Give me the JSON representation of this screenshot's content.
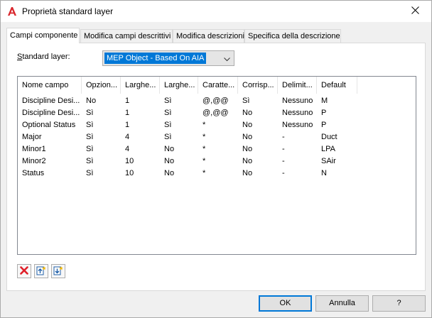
{
  "window": {
    "title": "Proprietà standard layer"
  },
  "tabs": [
    {
      "label": "Campi componente"
    },
    {
      "label": "Modifica campi descrittivi"
    },
    {
      "label": "Modifica descrizioni"
    },
    {
      "label": "Specifica della descrizione"
    }
  ],
  "standard": {
    "label_underlined": "S",
    "label_rest": "tandard layer:",
    "selected": "MEP Object - Based On AIA"
  },
  "table": {
    "columns": [
      "Nome campo",
      "Opzion...",
      "Larghe...",
      "Larghe...",
      "Caratte...",
      "Corrisp...",
      "Delimit...",
      "Default"
    ],
    "rows": [
      [
        "Discipline Desi...",
        "No",
        "1",
        "Sì",
        "@,@@",
        "Sì",
        "Nessuno",
        "M"
      ],
      [
        "Discipline Desi...",
        "Sì",
        "1",
        "Sì",
        "@,@@",
        "No",
        "Nessuno",
        "P"
      ],
      [
        "Optional Status",
        "Sì",
        "1",
        "Sì",
        "*",
        "No",
        "Nessuno",
        "P"
      ],
      [
        "Major",
        "Sì",
        "4",
        "Sì",
        "*",
        "No",
        "-",
        "Duct"
      ],
      [
        "Minor1",
        "Sì",
        "4",
        "No",
        "*",
        "No",
        "-",
        "LPA"
      ],
      [
        "Minor2",
        "Sì",
        "10",
        "No",
        "*",
        "No",
        "-",
        "SAir"
      ],
      [
        "Status",
        "Sì",
        "10",
        "No",
        "*",
        "No",
        "-",
        "N"
      ]
    ]
  },
  "toolbar_icons": [
    "delete-icon",
    "move-up-icon",
    "move-down-icon"
  ],
  "buttons": {
    "ok": "OK",
    "cancel": "Annulla",
    "help": "?"
  },
  "colors": {
    "accent": "#0078d7",
    "app_icon": "#d9262c",
    "delete": "#e0202a"
  }
}
